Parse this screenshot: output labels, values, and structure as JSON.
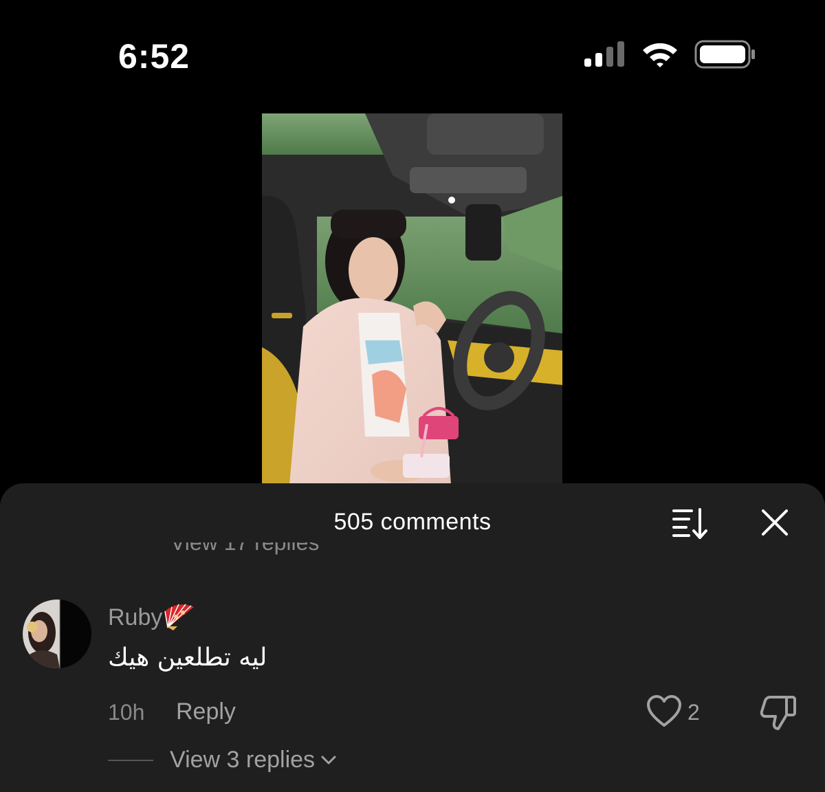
{
  "status_bar": {
    "time": "6:52"
  },
  "icons": {
    "signal": "cellular-signal-icon",
    "wifi": "wifi-icon",
    "battery": "battery-icon",
    "sort": "sort-icon",
    "close": "close-icon",
    "like": "heart-icon",
    "dislike": "thumbs-down-icon",
    "expand": "chevron-down-icon",
    "username_emoji": "folding-fan-icon"
  },
  "comments_sheet": {
    "title": "505 comments",
    "previous_replies_label": "View 17 replies",
    "comment": {
      "username": "Ruby",
      "text": "ليه تطلعين هيك",
      "time": "10h",
      "reply_label": "Reply",
      "like_count": "2",
      "view_replies_label": "View 3 replies"
    }
  },
  "colors": {
    "background": "#000000",
    "sheet": "#1f1f1f",
    "primary_text": "#ffffff",
    "secondary_text": "#9a9a9a"
  }
}
